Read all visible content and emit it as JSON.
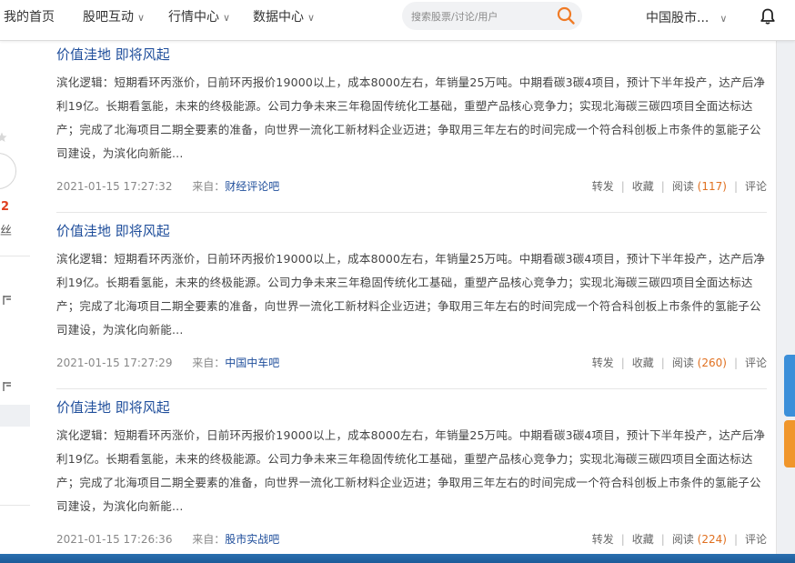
{
  "nav": {
    "home": "我的首页",
    "guba": "股吧互动",
    "market": "行情中心",
    "data": "数据中心",
    "chev": "∨"
  },
  "search": {
    "placeholder": "搜索股票/讨论/用户"
  },
  "market_select": {
    "label": "中国股市..."
  },
  "sidebar": {
    "num": "2",
    "fans": "丝"
  },
  "posts": [
    {
      "title": "价值洼地 即将风起",
      "body": "滨化逻辑：短期看环丙涨价，日前环丙报价19000以上，成本8000左右，年销量25万吨。中期看碳3碳4项目，预计下半年投产，达产后净利19亿。长期看氢能，未来的终极能源。公司力争未来三年稳固传统化工基础，重塑产品核心竞争力；实现北海碳三碳四项目全面达标达产；完成了北海项目二期全要素的准备，向世界一流化工新材料企业迈进；争取用三年左右的时间完成一个符合科创板上市条件的氢能子公司建设，为滨化向新能...",
      "time": "2021-01-15 17:27:32",
      "from": "来自：",
      "source": "财经评论吧",
      "forward": "转发",
      "collect": "收藏",
      "read": "阅读",
      "read_count": "(117)",
      "comment": "评论"
    },
    {
      "title": "价值洼地 即将风起",
      "body": "滨化逻辑：短期看环丙涨价，日前环丙报价19000以上，成本8000左右，年销量25万吨。中期看碳3碳4项目，预计下半年投产，达产后净利19亿。长期看氢能，未来的终极能源。公司力争未来三年稳固传统化工基础，重塑产品核心竞争力；实现北海碳三碳四项目全面达标达产；完成了北海项目二期全要素的准备，向世界一流化工新材料企业迈进；争取用三年左右的时间完成一个符合科创板上市条件的氢能子公司建设，为滨化向新能...",
      "time": "2021-01-15 17:27:29",
      "from": "来自：",
      "source": "中国中车吧",
      "forward": "转发",
      "collect": "收藏",
      "read": "阅读",
      "read_count": "(260)",
      "comment": "评论"
    },
    {
      "title": "价值洼地 即将风起",
      "body": "滨化逻辑：短期看环丙涨价，日前环丙报价19000以上，成本8000左右，年销量25万吨。中期看碳3碳4项目，预计下半年投产，达产后净利19亿。长期看氢能，未来的终极能源。公司力争未来三年稳固传统化工基础，重塑产品核心竞争力；实现北海碳三碳四项目全面达标达产；完成了北海项目二期全要素的准备，向世界一流化工新材料企业迈进；争取用三年左右的时间完成一个符合科创板上市条件的氢能子公司建设，为滨化向新能...",
      "time": "2021-01-15 17:26:36",
      "from": "来自：",
      "source": "股市实战吧",
      "forward": "转发",
      "collect": "收藏",
      "read": "阅读",
      "read_count": "(224)",
      "comment": "评论"
    }
  ],
  "colors": {
    "link": "#1f4e9b",
    "accent": "#e07020",
    "search_icon": "#f07b26"
  }
}
